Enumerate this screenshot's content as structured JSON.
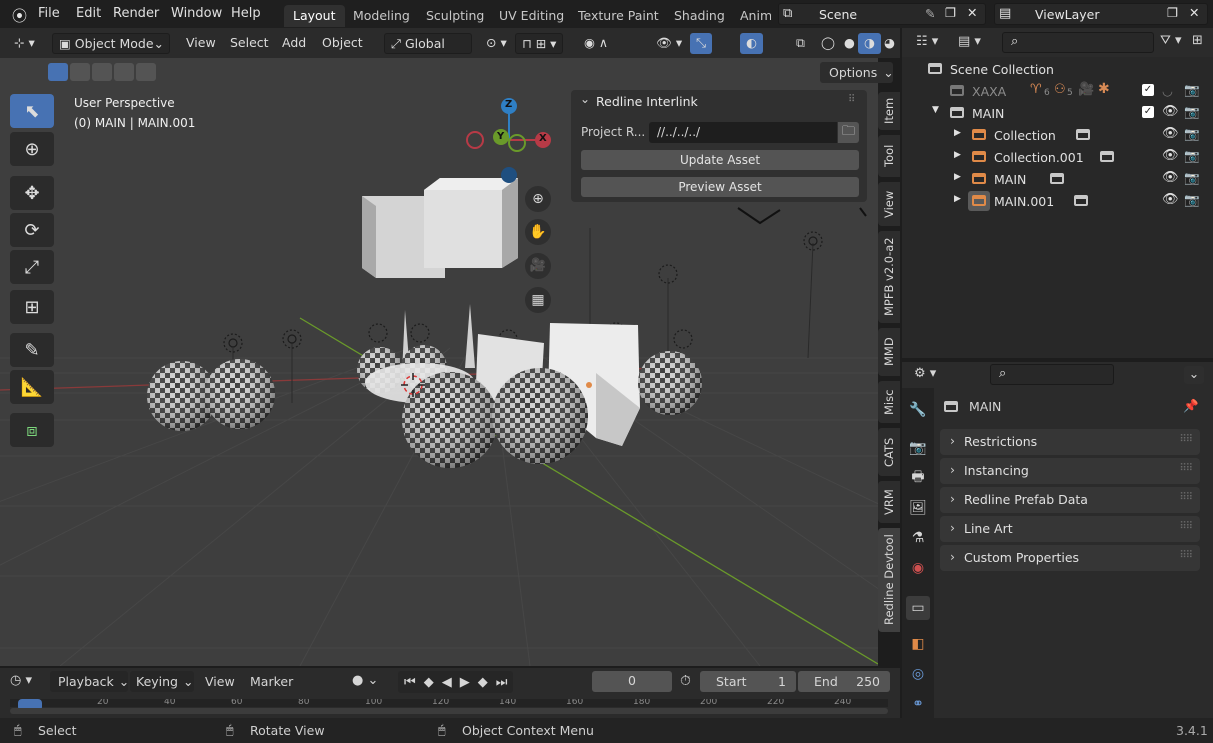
{
  "topbar": {
    "menus": [
      "File",
      "Edit",
      "Render",
      "Window",
      "Help"
    ],
    "workspaces": [
      "Layout",
      "Modeling",
      "Sculpting",
      "UV Editing",
      "Texture Paint",
      "Shading",
      "Anim"
    ],
    "scene": "Scene",
    "view_layer": "ViewLayer"
  },
  "viewport_header": {
    "mode": "Object Mode",
    "menus": [
      "View",
      "Select",
      "Add",
      "Object"
    ],
    "orientation": "Global",
    "options_label": "Options"
  },
  "overlay": {
    "perspective": "User Perspective",
    "collection_info": "(0) MAIN | MAIN.001"
  },
  "gizmo": {
    "x": "X",
    "y": "Y",
    "z": "Z"
  },
  "npanel": {
    "title": "Redline Interlink",
    "project_root_label": "Project R...",
    "project_root_value": "//../../../",
    "update_button": "Update Asset",
    "preview_button": "Preview Asset",
    "tabs": [
      "Item",
      "Tool",
      "View",
      "MPFB v2.0-a2",
      "MMD",
      "Misc",
      "CATS",
      "VRM",
      "Redline Devtool"
    ]
  },
  "outliner": {
    "search_placeholder": "",
    "root": "Scene Collection",
    "items": [
      {
        "label": "XAXA",
        "counts": [
          "6",
          "5"
        ]
      },
      {
        "label": "MAIN"
      },
      {
        "label": "Collection"
      },
      {
        "label": "Collection.001"
      },
      {
        "label": "MAIN"
      },
      {
        "label": "MAIN.001"
      }
    ]
  },
  "properties": {
    "object_name": "MAIN",
    "sections": [
      "Restrictions",
      "Instancing",
      "Redline Prefab Data",
      "Line Art",
      "Custom Properties"
    ]
  },
  "timeline": {
    "menus": [
      "Playback",
      "Keying",
      "View",
      "Marker"
    ],
    "current_frame": "0",
    "start_label": "Start",
    "start_value": "1",
    "end_label": "End",
    "end_value": "250",
    "ruler_marks": [
      "0",
      "20",
      "40",
      "60",
      "80",
      "100",
      "120",
      "140",
      "160",
      "180",
      "200",
      "220",
      "240"
    ]
  },
  "statusbar": {
    "select": "Select",
    "rotate": "Rotate View",
    "context": "Object Context Menu",
    "version": "3.4.1"
  },
  "colors": {
    "accent": "#4772b3",
    "viewport_bg": "#3e3e3e",
    "panel_bg": "#2b2b2b",
    "x_axis": "#b73a46",
    "y_axis": "#6a9a2a",
    "z_axis": "#2f7fc4",
    "collection_orange": "#e08a48"
  }
}
